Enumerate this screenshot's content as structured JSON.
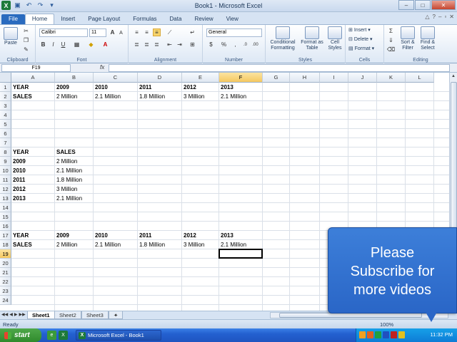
{
  "window": {
    "title": "Book1 - Microsoft Excel",
    "minimize": "–",
    "maximize": "□",
    "close": "✕"
  },
  "ribbon_tabs": [
    "File",
    "Home",
    "Insert",
    "Page Layout",
    "Formulas",
    "Data",
    "Review",
    "View"
  ],
  "ribbon": {
    "clipboard": {
      "paste": "Paste",
      "label": "Clipboard"
    },
    "font": {
      "name": "Calibri",
      "size": "11",
      "label": "Font"
    },
    "alignment": {
      "label": "Alignment"
    },
    "number": {
      "format": "General",
      "label": "Number"
    },
    "styles": {
      "conditional": "Conditional Formatting",
      "format_table": "Format as Table",
      "cell_styles": "Cell Styles",
      "label": "Styles"
    },
    "cells": {
      "insert": "Insert",
      "delete": "Delete",
      "format": "Format",
      "label": "Cells"
    },
    "editing": {
      "sort": "Sort & Filter",
      "find": "Find & Select",
      "label": "Editing"
    }
  },
  "formula_bar": {
    "name_box": "F19",
    "fx": "fx",
    "formula": ""
  },
  "columns": [
    "A",
    "B",
    "C",
    "D",
    "E",
    "F",
    "G",
    "H",
    "I",
    "J",
    "K",
    "L"
  ],
  "rows": [
    "1",
    "2",
    "3",
    "4",
    "5",
    "6",
    "7",
    "8",
    "9",
    "10",
    "11",
    "12",
    "13",
    "14",
    "15",
    "16",
    "17",
    "18",
    "19",
    "20",
    "21",
    "22",
    "23",
    "24"
  ],
  "active_cell": "F19",
  "cells": {
    "A1": "YEAR",
    "B1": "2009",
    "C1": "2010",
    "D1": "2011",
    "E1": "2012",
    "F1": "2013",
    "A2": "SALES",
    "B2": "2 Million",
    "C2": "2.1 Million",
    "D2": "1.8 Million",
    "E2": "3 Million",
    "F2": "2.1 Million",
    "A8": "YEAR",
    "B8": "SALES",
    "A9": "2009",
    "B9": "2 Million",
    "A10": "2010",
    "B10": "2.1 Million",
    "A11": "2011",
    "B11": "1.8 Million",
    "A12": "2012",
    "B12": "3 Million",
    "A13": "2013",
    "B13": "2.1 Million",
    "A17": "YEAR",
    "B17": "2009",
    "C17": "2010",
    "D17": "2011",
    "E17": "2012",
    "F17": "2013",
    "A18": "SALES",
    "B18": "2 Million",
    "C18": "2.1 Million",
    "D18": "1.8 Million",
    "E18": "3 Million",
    "F18": "2.1 Million"
  },
  "sheets": [
    "Sheet1",
    "Sheet2",
    "Sheet3"
  ],
  "status": {
    "ready": "Ready",
    "zoom": "100%"
  },
  "taskbar": {
    "start": "start",
    "task": "Microsoft Excel - Book1",
    "clock": "11:32 PM"
  },
  "overlay": {
    "line1": "Please",
    "line2": "Subscribe for",
    "line3": "more videos"
  }
}
